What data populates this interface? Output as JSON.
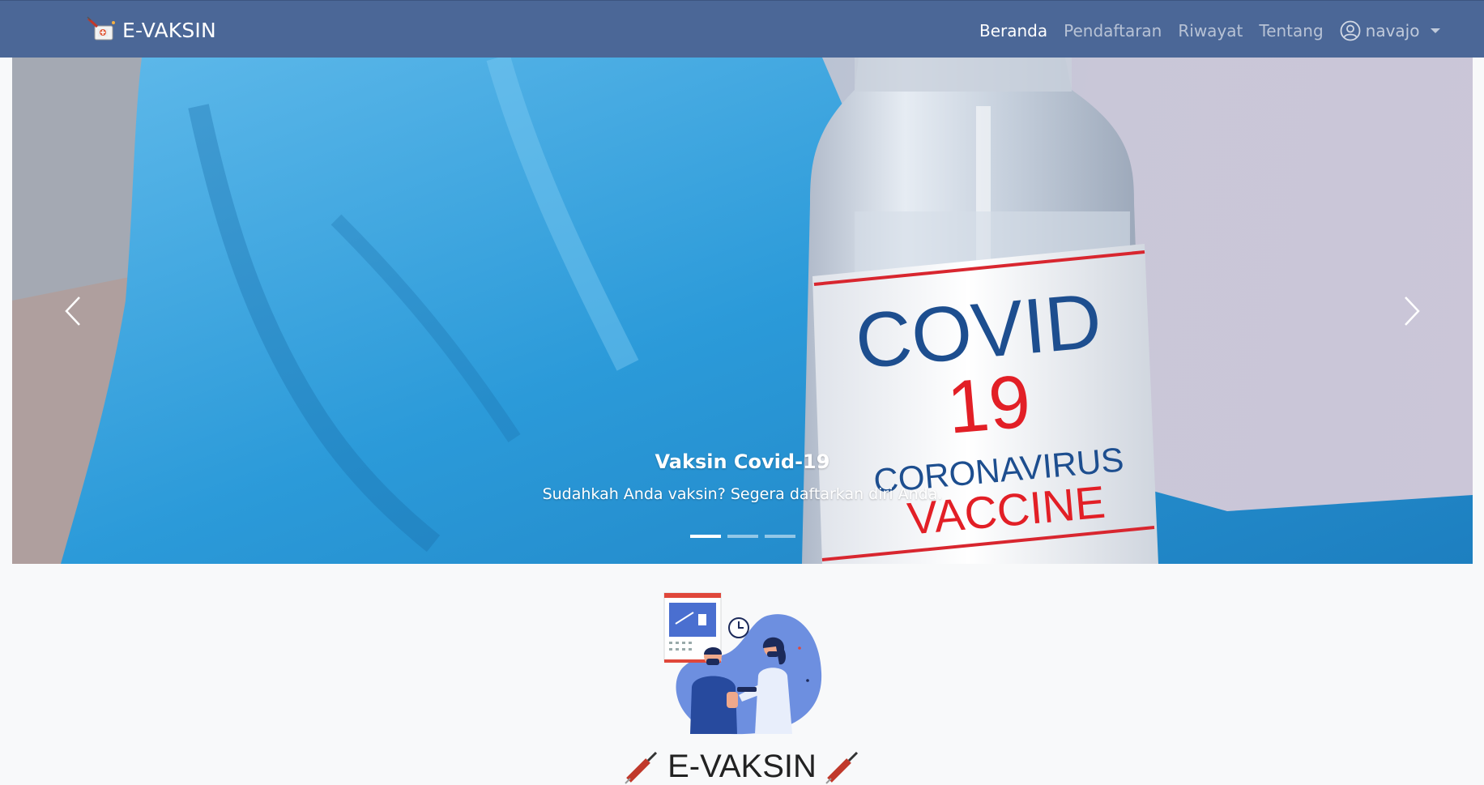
{
  "navbar": {
    "brand": "E-VAKSIN",
    "links": [
      "Beranda",
      "Pendaftaran",
      "Riwayat",
      "Tentang"
    ],
    "active_index": 0,
    "user_name": "navajo",
    "bg_color": "#4b6797"
  },
  "carousel": {
    "slide_title": "Vaksin Covid-19",
    "slide_text": "Sudahkah Anda vaksin? Segera daftarkan diri Anda.",
    "vial_label": {
      "line1": "COVID",
      "line2": "19",
      "line3": "CORONAVIRUS",
      "line4": "VACCINE"
    },
    "indicators_count": 3,
    "active_indicator": 0
  },
  "section": {
    "heading": "E-VAKSIN"
  }
}
